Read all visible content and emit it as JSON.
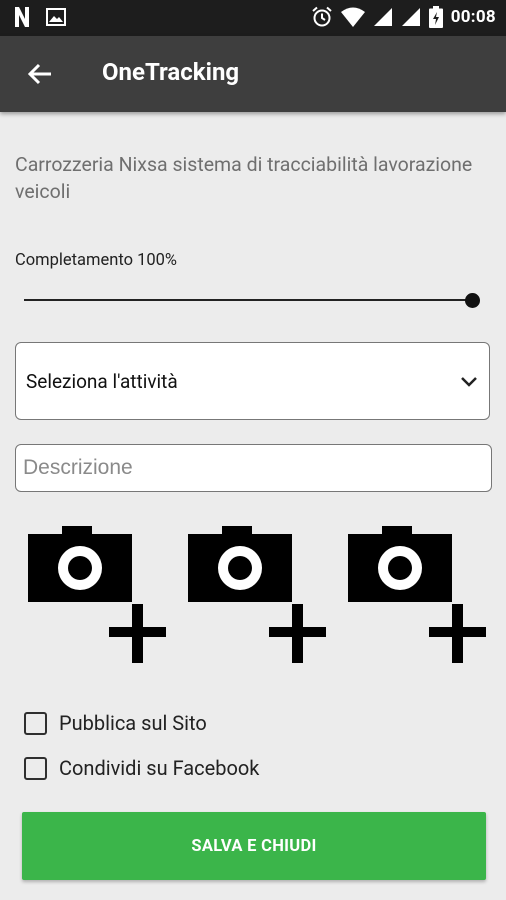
{
  "status_bar": {
    "time": "00:08",
    "left_icons": [
      "netflix-icon",
      "image-icon"
    ],
    "right_icons": [
      "alarm-icon",
      "wifi-icon",
      "signal-icon",
      "signal-icon",
      "battery-charging-icon"
    ]
  },
  "app_bar": {
    "title": "OneTracking",
    "back_icon": "arrow-left-icon"
  },
  "main": {
    "description": "Carrozzeria Nixsa sistema di tracciabilità lavorazione veicoli",
    "progress": {
      "label": "Completamento 100%",
      "value_percent": 100
    },
    "activity_select": {
      "selected": "Seleziona l'attività",
      "icon": "chevron-down-icon"
    },
    "description_input": {
      "placeholder": "Descrizione",
      "value": ""
    },
    "photo_buttons": [
      {
        "icon": "add-photo-icon"
      },
      {
        "icon": "add-photo-icon"
      },
      {
        "icon": "add-photo-icon"
      }
    ],
    "checkboxes": [
      {
        "label": "Pubblica sul Sito",
        "checked": false
      },
      {
        "label": "Condividi su Facebook",
        "checked": false
      }
    ],
    "save_button": {
      "label": "SALVA E CHIUDI",
      "color": "#3bb54a"
    }
  },
  "colors": {
    "status_bar": "#1d1d1d",
    "app_bar": "#3e3e3e",
    "background": "#ececec",
    "accent_green": "#3bb54a"
  }
}
